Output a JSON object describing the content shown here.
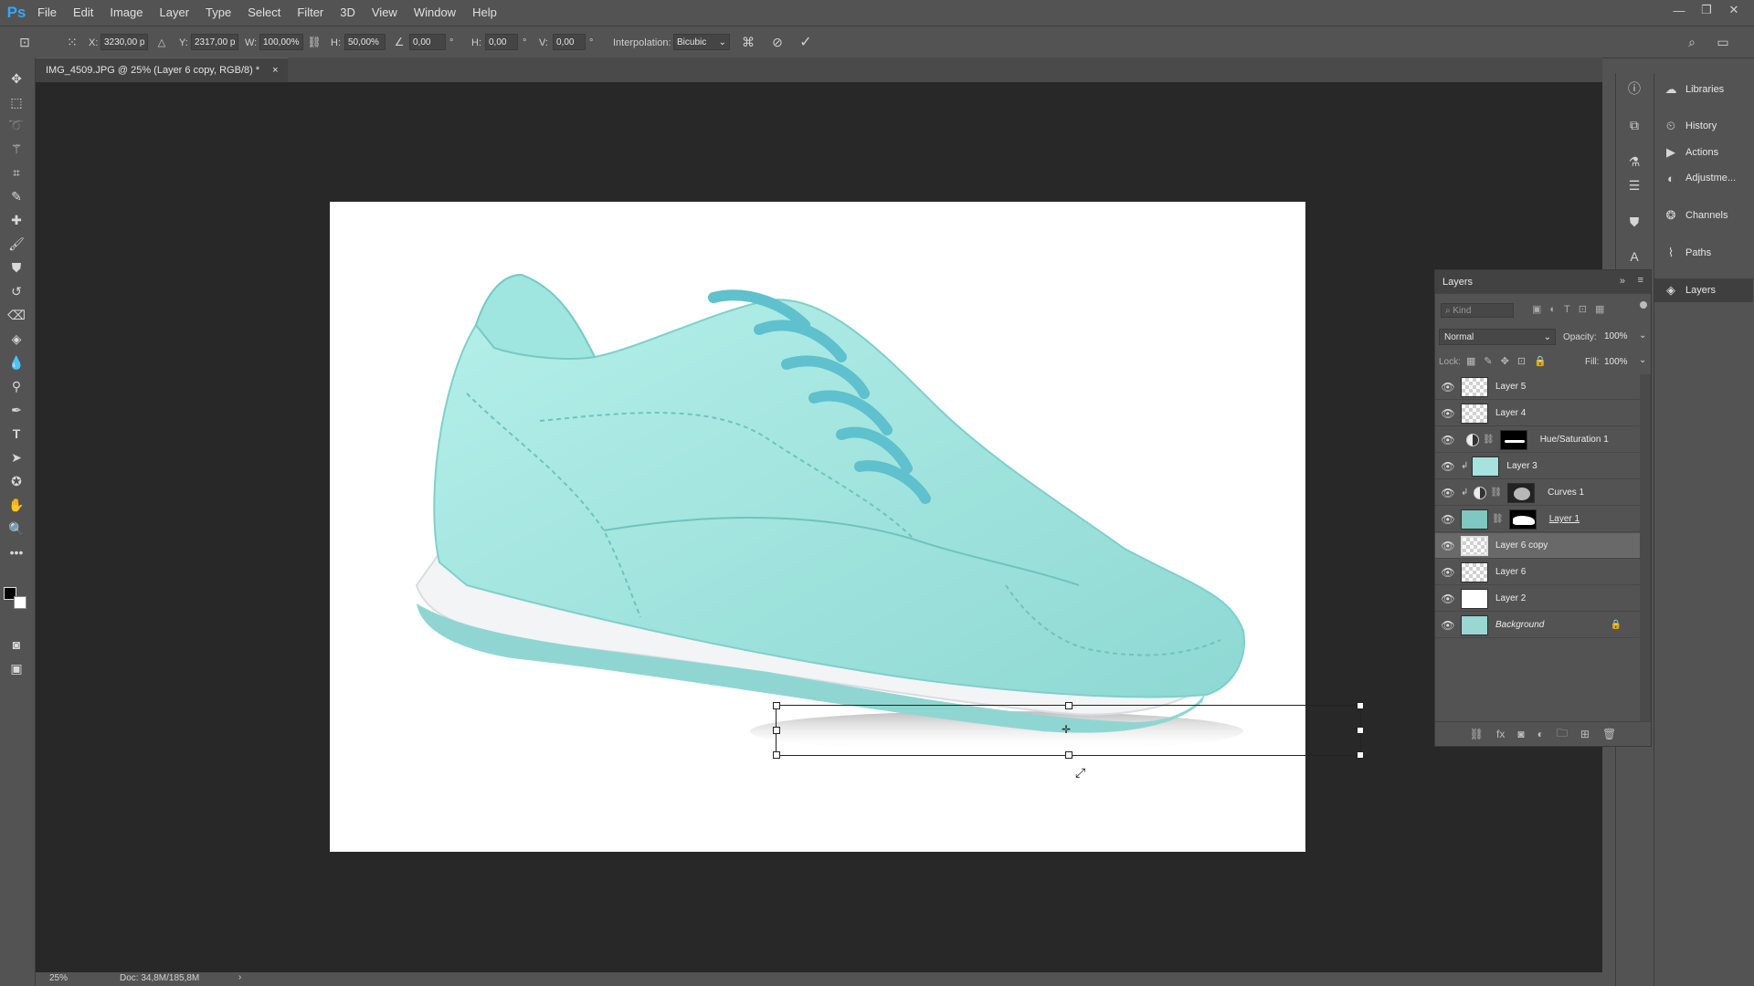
{
  "app": {
    "logo": "Ps",
    "menu": [
      "File",
      "Edit",
      "Image",
      "Layer",
      "Type",
      "Select",
      "Filter",
      "3D",
      "View",
      "Window",
      "Help"
    ],
    "window_buttons": [
      "minimize-icon",
      "restore-icon",
      "close-icon"
    ]
  },
  "options": {
    "x_label": "X:",
    "x_value": "3230,00 p",
    "y_label": "Y:",
    "y_value": "2317,00 p",
    "w_label": "W:",
    "w_value": "100,00%",
    "h_label": "H:",
    "h_value": "50,00%",
    "angle_value": "0,00",
    "deg1": "°",
    "hskew_label": "H:",
    "hskew_value": "0,00",
    "deg2": "°",
    "vskew_label": "V:",
    "vskew_value": "0,00",
    "deg3": "°",
    "interp_label": "Interpolation:",
    "interp_value": "Bicubic"
  },
  "document": {
    "tab_title": "IMG_4509.JPG @ 25% (Layer 6 copy, RGB/8) *",
    "close": "×"
  },
  "status": {
    "zoom": "25%",
    "doc_size": "Doc: 34,8M/185,8M",
    "arrow": "›"
  },
  "right_panels": {
    "items": [
      "Libraries",
      "History",
      "Actions",
      "Adjustme...",
      "Channels",
      "Paths",
      "Layers"
    ]
  },
  "layers_panel": {
    "title": "Layers",
    "kind_placeholder": "Kind",
    "blend_mode": "Normal",
    "opacity_label": "Opacity:",
    "opacity_value": "100%",
    "lock_label": "Lock:",
    "fill_label": "Fill:",
    "fill_value": "100%",
    "layers": [
      {
        "name": "Layer 5"
      },
      {
        "name": "Layer 4"
      },
      {
        "name": "Hue/Saturation 1"
      },
      {
        "name": "Layer 3"
      },
      {
        "name": "Curves 1"
      },
      {
        "name": "Layer 1"
      },
      {
        "name": "Layer 6 copy"
      },
      {
        "name": "Layer 6"
      },
      {
        "name": "Layer 2"
      },
      {
        "name": "Background"
      }
    ]
  },
  "colors": {
    "accent": "#31a8ff",
    "shoe": "#9fe3dc",
    "shoe_dark": "#6cc9c6",
    "sole": "#f2f4f6",
    "canvas_bg": "#282828"
  }
}
